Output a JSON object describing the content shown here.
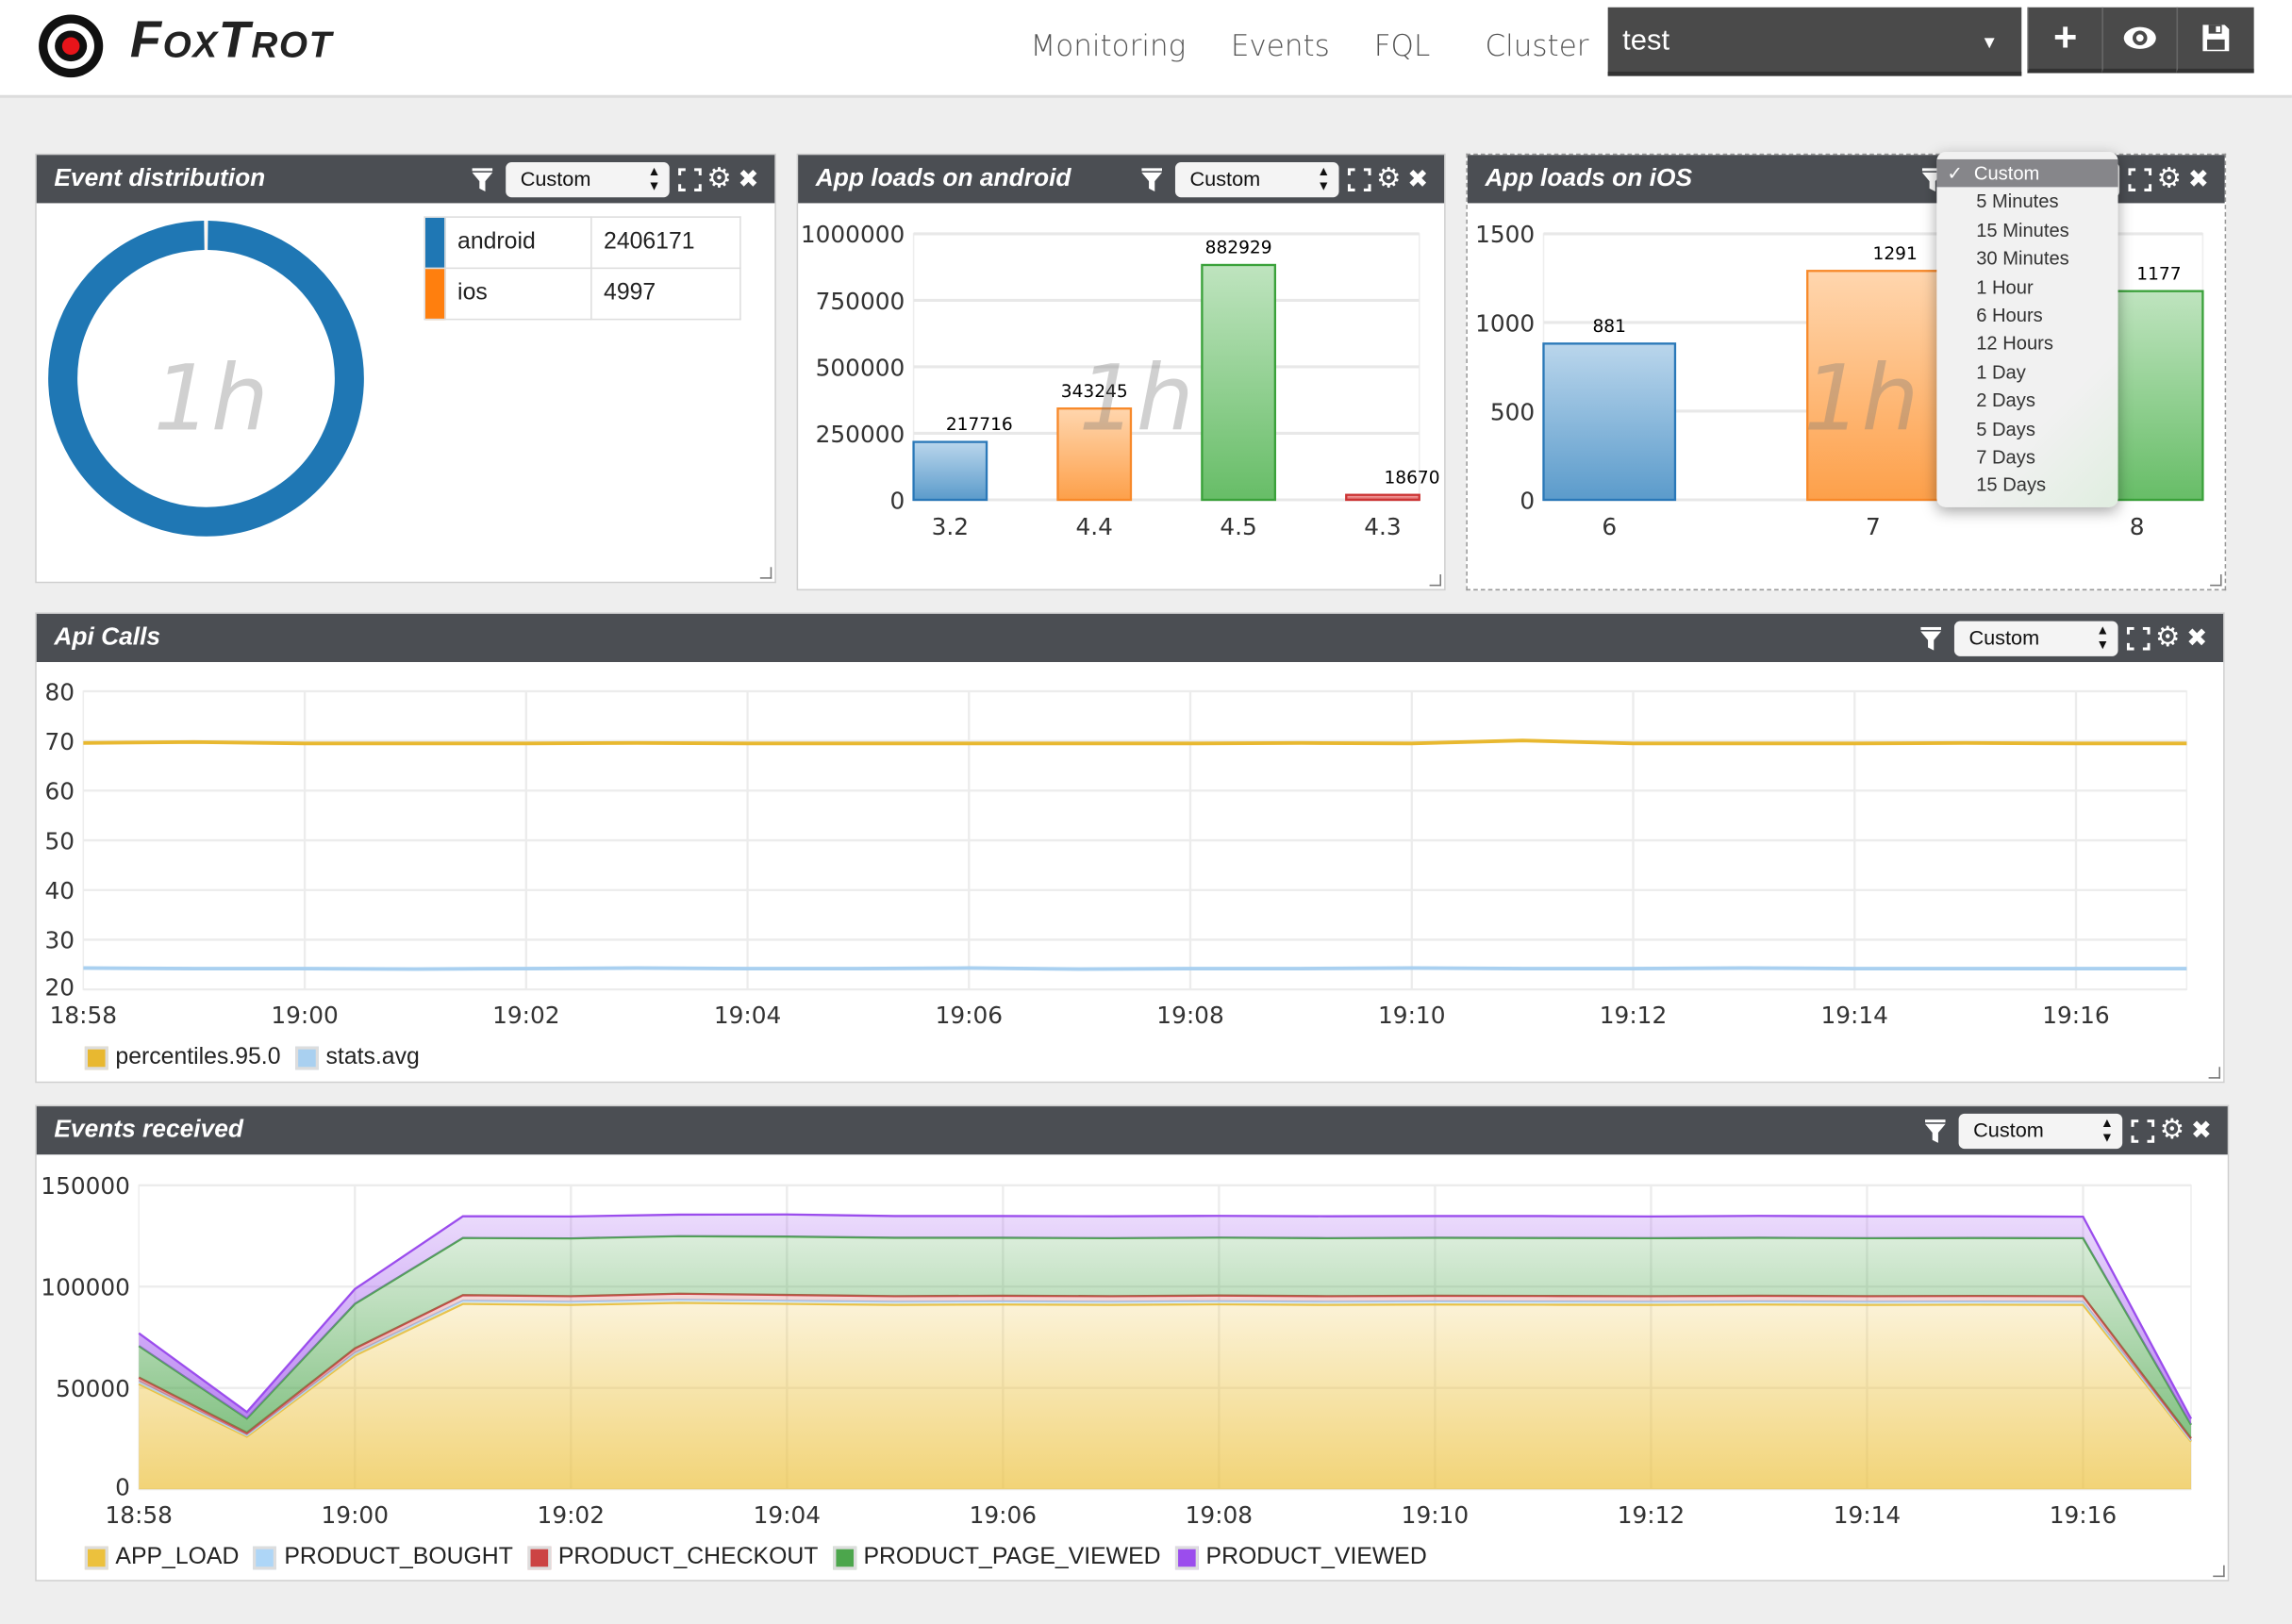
{
  "app": {
    "brand": "FoxTrot"
  },
  "nav": [
    {
      "label": "Monitoring"
    },
    {
      "label": "Events"
    },
    {
      "label": "FQL"
    },
    {
      "label": "Cluster"
    }
  ],
  "dashboard_select": {
    "value": "test"
  },
  "toolbar": {
    "icons": [
      "plus-icon",
      "eye-icon",
      "save-icon"
    ]
  },
  "colors": {
    "header": "#4b4e53",
    "blue": "#1f77b4",
    "orange": "#ff7f0e",
    "green": "#2ca02c",
    "red": "#d62728"
  },
  "panels": {
    "event_distribution": {
      "title": "Event distribution",
      "period": "Custom",
      "watermark": "1h",
      "chart_data": {
        "type": "pie",
        "donut": true,
        "categories": [
          "android",
          "ios"
        ],
        "values": [
          2406171,
          4997
        ],
        "colors": [
          "#1f77b4",
          "#ff7f0e"
        ]
      }
    },
    "android": {
      "title": "App loads on android",
      "period": "Custom",
      "watermark": "1h",
      "chart_data": {
        "type": "bar",
        "categories": [
          "3.2",
          "4.4",
          "4.5",
          "4.3"
        ],
        "values": [
          217716,
          343245,
          882929,
          18670
        ],
        "ylim": [
          0,
          1000000
        ],
        "yticks": [
          "0",
          "250000",
          "500000",
          "750000",
          "1000000"
        ],
        "colors": [
          "blue",
          "orange",
          "green",
          "red"
        ]
      }
    },
    "ios": {
      "title": "App loads on iOS",
      "period": "Custom",
      "watermark": "1h",
      "chart_data": {
        "type": "bar",
        "categories": [
          "6",
          "7",
          "8"
        ],
        "values": [
          881,
          1291,
          1177
        ],
        "ylim": [
          0,
          1500
        ],
        "yticks": [
          "0",
          "500",
          "1000",
          "1500"
        ],
        "colors": [
          "blue",
          "orange",
          "green"
        ]
      },
      "dropdown": {
        "options": [
          "Custom",
          "5 Minutes",
          "15 Minutes",
          "30 Minutes",
          "1 Hour",
          "6 Hours",
          "12 Hours",
          "1 Day",
          "2 Days",
          "5 Days",
          "7 Days",
          "15 Days"
        ],
        "selected": "Custom"
      }
    },
    "api_calls": {
      "title": "Api Calls",
      "period": "Custom",
      "chart_data": {
        "type": "line",
        "x": [
          "18:58",
          "18:59",
          "19:00",
          "19:01",
          "19:02",
          "19:03",
          "19:04",
          "19:05",
          "19:06",
          "19:07",
          "19:08",
          "19:09",
          "19:10",
          "19:11",
          "19:12",
          "19:13",
          "19:14",
          "19:15",
          "19:16",
          "19:17"
        ],
        "xticks": [
          "18:58",
          "19:00",
          "19:02",
          "19:04",
          "19:06",
          "19:08",
          "19:10",
          "19:12",
          "19:14",
          "19:16"
        ],
        "ylim": [
          20,
          80
        ],
        "yticks": [
          "20",
          "30",
          "40",
          "50",
          "60",
          "70",
          "80"
        ],
        "grid": true,
        "legend": "bottom-left",
        "series": [
          {
            "name": "percentiles.95.0",
            "color": "#e8b830",
            "values": [
              69.6,
              69.8,
              69.5,
              69.5,
              69.5,
              69.6,
              69.5,
              69.5,
              69.5,
              69.5,
              69.5,
              69.6,
              69.5,
              70.1,
              69.5,
              69.5,
              69.5,
              69.6,
              69.5,
              69.5
            ]
          },
          {
            "name": "stats.avg",
            "color": "#a9d0f0",
            "values": [
              24.3,
              24.2,
              24.2,
              24.1,
              24.2,
              24.3,
              24.2,
              24.2,
              24.3,
              24.1,
              24.2,
              24.2,
              24.3,
              24.2,
              24.2,
              24.3,
              24.2,
              24.2,
              24.2,
              24.2
            ]
          }
        ]
      }
    },
    "events_received": {
      "title": "Events received",
      "period": "Custom",
      "chart_data": {
        "type": "area",
        "stacked": true,
        "x": [
          "18:58",
          "18:59",
          "19:00",
          "19:01",
          "19:02",
          "19:03",
          "19:04",
          "19:05",
          "19:06",
          "19:07",
          "19:08",
          "19:09",
          "19:10",
          "19:11",
          "19:12",
          "19:13",
          "19:14",
          "19:15",
          "19:16",
          "19:17"
        ],
        "xticks": [
          "18:58",
          "19:00",
          "19:02",
          "19:04",
          "19:06",
          "19:08",
          "19:10",
          "19:12",
          "19:14",
          "19:16"
        ],
        "ylim": [
          0,
          150000
        ],
        "yticks": [
          "0",
          "50000",
          "100000",
          "150000"
        ],
        "grid": true,
        "legend": "bottom-left",
        "series": [
          {
            "name": "APP_LOAD",
            "color": "#ecc13d",
            "values": [
              52000,
              26000,
              66000,
              91500,
              91000,
              92000,
              91500,
              91000,
              91200,
              91000,
              91300,
              91000,
              91200,
              91100,
              91000,
              91200,
              91000,
              91100,
              91000,
              23500
            ]
          },
          {
            "name": "PRODUCT_BOUGHT",
            "color": "#aed6f7",
            "values": [
              1200,
              700,
              1200,
              1500,
              1500,
              1500,
              1500,
              1500,
              1500,
              1500,
              1500,
              1500,
              1500,
              1500,
              1500,
              1500,
              1500,
              1500,
              1500,
              600
            ]
          },
          {
            "name": "PRODUCT_CHECKOUT",
            "color": "#cc4444",
            "values": [
              2000,
              1200,
              2300,
              2800,
              2800,
              3000,
              2900,
              2800,
              2800,
              2800,
              2800,
              2800,
              2800,
              2800,
              2800,
              2800,
              2800,
              2800,
              2800,
              1100
            ]
          },
          {
            "name": "PRODUCT_PAGE_VIEWED",
            "color": "#4ca64c",
            "values": [
              15500,
              7000,
              22000,
              28200,
              28500,
              28400,
              28800,
              28800,
              28600,
              28600,
              28600,
              28600,
              28600,
              28600,
              28600,
              28600,
              28600,
              28600,
              28600,
              6600
            ]
          },
          {
            "name": "PRODUCT_VIEWED",
            "color": "#9b4ded",
            "values": [
              6300,
              3200,
              7300,
              10700,
              10800,
              10600,
              10900,
              10700,
              10700,
              10800,
              10700,
              10800,
              10700,
              10800,
              10700,
              10800,
              10800,
              10700,
              10600,
              3000
            ]
          }
        ]
      }
    }
  }
}
